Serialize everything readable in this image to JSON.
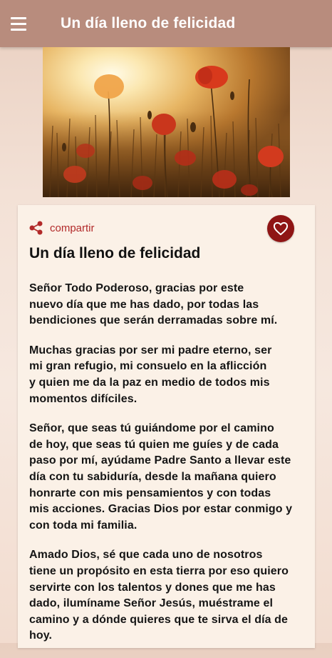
{
  "appbar": {
    "title": "Un día lleno de felicidad",
    "menu_icon": "hamburger-menu-icon"
  },
  "hero": {
    "description_icon": "poppy-field-image"
  },
  "card": {
    "share_label": "compartir",
    "share_icon": "share-icon",
    "favorite_icon": "heart-icon",
    "title": "Un día lleno de felicidad",
    "paragraphs": [
      "Señor Todo Poderoso, gracias por este\nnuevo día que me has dado, por todas las\nbendiciones que serán derramadas sobre mí.",
      "Muchas gracias por ser mi padre eterno, ser\nmi gran refugio, mi consuelo en la aflicción\ny quien me da la paz en medio de todos mis\nmomentos difíciles.",
      "Señor, que seas tú guiándome por el camino\nde hoy, que seas tú quien me guíes y de cada\npaso por mí, ayúdame Padre Santo a llevar este\ndía con tu sabiduría, desde la mañana quiero\nhonrarte con mis pensamientos y con todas\nmis acciones. Gracias Dios por estar conmigo y\ncon toda mi familia.",
      "Amado Dios, sé que cada uno de nosotros\ntiene un propósito en esta tierra por eso quiero\nservirte con los talentos y dones que me has\ndado, ilumíname Señor Jesús, muéstrame el\ncamino y a dónde quieres que te sirva el día de\nhoy."
    ]
  },
  "colors": {
    "appbar": "#b88c7d",
    "accent": "#b22a2a",
    "favorite_bg": "#8f1515",
    "card_bg": "#fbf1e7"
  }
}
